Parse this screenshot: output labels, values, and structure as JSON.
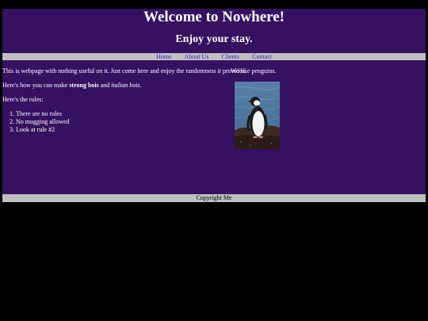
{
  "header": {
    "title": "Welcome to Nowhere!",
    "subtitle": "Enjoy your stay."
  },
  "nav": {
    "links": [
      "Home",
      "About Us",
      "Clients",
      "Contact"
    ]
  },
  "content": {
    "intro": "This is webpage with nothing useful on it. Just come here and enjoy the randomness it provides.",
    "penguin_note": "We like penguins.",
    "make_prefix": "Here's how you can make ",
    "strong_text": "strong bois",
    "make_and": " and ",
    "italic_text": "italian bois",
    "make_suffix": ".",
    "rules_heading": "Here's the rules:",
    "rules": [
      "There are no rules",
      "No mugging allowed",
      "Look at rule #2"
    ]
  },
  "footer": {
    "copyright": "Copyright Me"
  },
  "colors": {
    "page_background": "#361162",
    "outer_background": "#000000",
    "bar_background": "#c0c0c0",
    "link_color": "#2a24c8"
  },
  "icons": {
    "image": "penguin-photo"
  }
}
